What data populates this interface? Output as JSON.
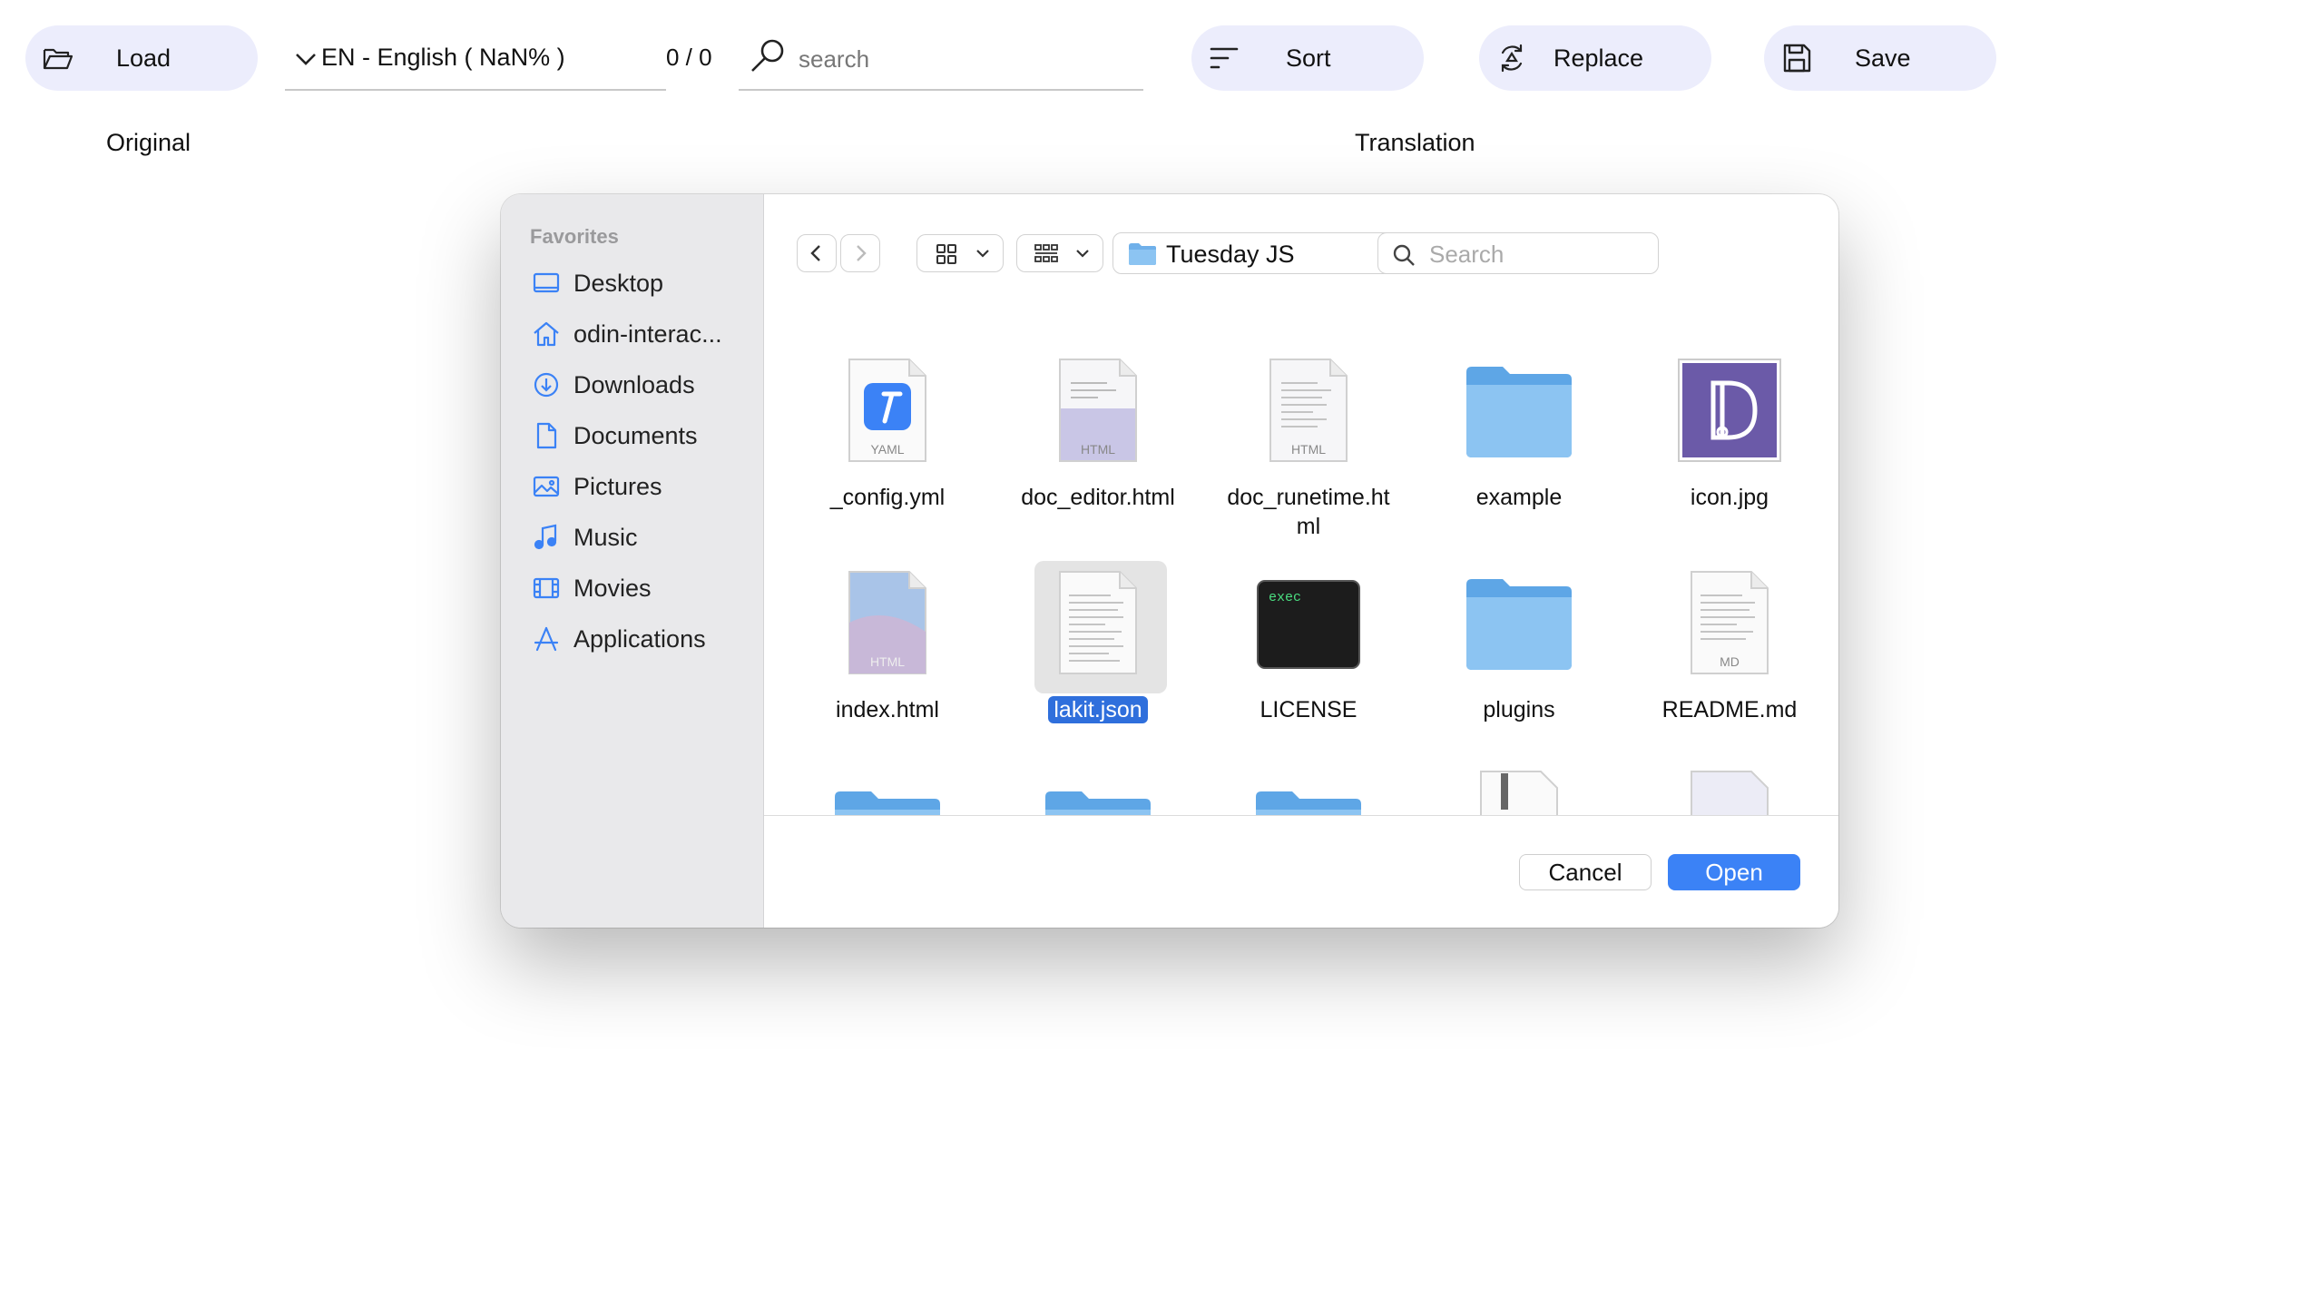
{
  "toolbar": {
    "load_label": "Load",
    "language_label": "EN - English ( NaN% )",
    "counter": "0 / 0",
    "search_placeholder": "search",
    "sort_label": "Sort",
    "replace_label": "Replace",
    "save_label": "Save"
  },
  "columns": {
    "original": "Original",
    "translation": "Translation"
  },
  "dialog": {
    "sidebar": {
      "section": "Favorites",
      "items": [
        {
          "label": "Desktop",
          "icon": "desktop-icon"
        },
        {
          "label": "odin-interac...",
          "icon": "home-icon"
        },
        {
          "label": "Downloads",
          "icon": "downloads-icon"
        },
        {
          "label": "Documents",
          "icon": "document-icon"
        },
        {
          "label": "Pictures",
          "icon": "pictures-icon"
        },
        {
          "label": "Music",
          "icon": "music-icon"
        },
        {
          "label": "Movies",
          "icon": "movies-icon"
        },
        {
          "label": "Applications",
          "icon": "applications-icon"
        }
      ]
    },
    "location": "Tuesday JS",
    "search_placeholder": "Search",
    "files": [
      {
        "name": "_config.yml",
        "kind": "yaml",
        "badge": "YAML"
      },
      {
        "name": "doc_editor.html",
        "kind": "html",
        "badge": "HTML"
      },
      {
        "name": "doc_runetime.html",
        "kind": "html",
        "badge": "HTML"
      },
      {
        "name": "example",
        "kind": "folder"
      },
      {
        "name": "icon.jpg",
        "kind": "image"
      },
      {
        "name": "index.html",
        "kind": "html-preview",
        "badge": "HTML"
      },
      {
        "name": "lakit.json",
        "kind": "document",
        "selected": true
      },
      {
        "name": "LICENSE",
        "kind": "exec",
        "badge": "exec"
      },
      {
        "name": "plugins",
        "kind": "folder"
      },
      {
        "name": "README.md",
        "kind": "md",
        "badge": "MD"
      }
    ],
    "cancel_label": "Cancel",
    "open_label": "Open",
    "accent_color": "#3b82f6"
  }
}
